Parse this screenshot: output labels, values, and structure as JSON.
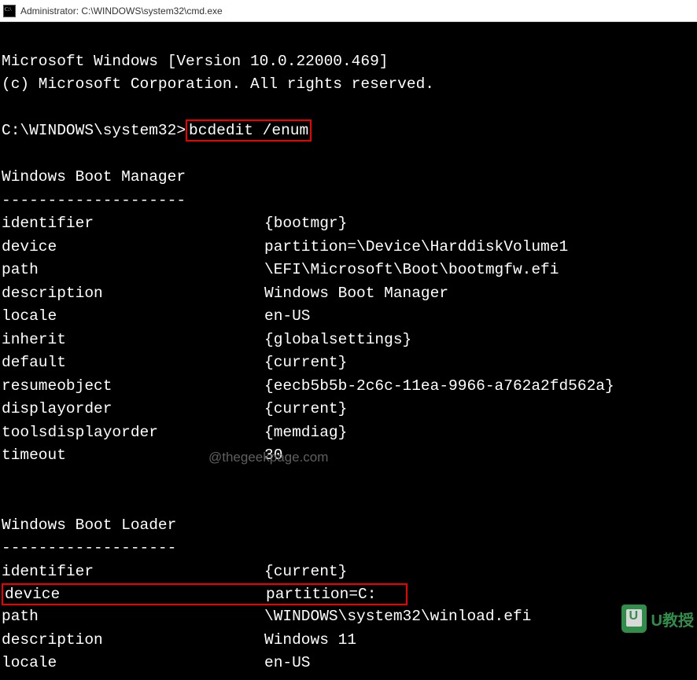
{
  "titlebar": {
    "text": "Administrator: C:\\WINDOWS\\system32\\cmd.exe"
  },
  "terminal": {
    "banner1": "Microsoft Windows [Version 10.0.22000.469]",
    "banner2": "(c) Microsoft Corporation. All rights reserved.",
    "prompt": "C:\\WINDOWS\\system32>",
    "command": "bcdedit /enum",
    "section1": {
      "title": "Windows Boot Manager",
      "divider": "--------------------",
      "rows": [
        {
          "k": "identifier",
          "v": "{bootmgr}"
        },
        {
          "k": "device",
          "v": "partition=\\Device\\HarddiskVolume1"
        },
        {
          "k": "path",
          "v": "\\EFI\\Microsoft\\Boot\\bootmgfw.efi"
        },
        {
          "k": "description",
          "v": "Windows Boot Manager"
        },
        {
          "k": "locale",
          "v": "en-US"
        },
        {
          "k": "inherit",
          "v": "{globalsettings}"
        },
        {
          "k": "default",
          "v": "{current}"
        },
        {
          "k": "resumeobject",
          "v": "{eecb5b5b-2c6c-11ea-9966-a762a2fd562a}"
        },
        {
          "k": "displayorder",
          "v": "{current}"
        },
        {
          "k": "toolsdisplayorder",
          "v": "{memdiag}"
        },
        {
          "k": "timeout",
          "v": "30"
        }
      ]
    },
    "section2": {
      "title": "Windows Boot Loader",
      "divider": "-------------------",
      "rows": [
        {
          "k": "identifier",
          "v": "{current}"
        },
        {
          "k": "device",
          "v": "partition=C:",
          "highlight": true
        },
        {
          "k": "path",
          "v": "\\WINDOWS\\system32\\winload.efi"
        },
        {
          "k": "description",
          "v": "Windows 11"
        },
        {
          "k": "locale",
          "v": "en-US"
        }
      ]
    }
  },
  "watermark": "@thegeekpage.com",
  "logo": "U教授"
}
